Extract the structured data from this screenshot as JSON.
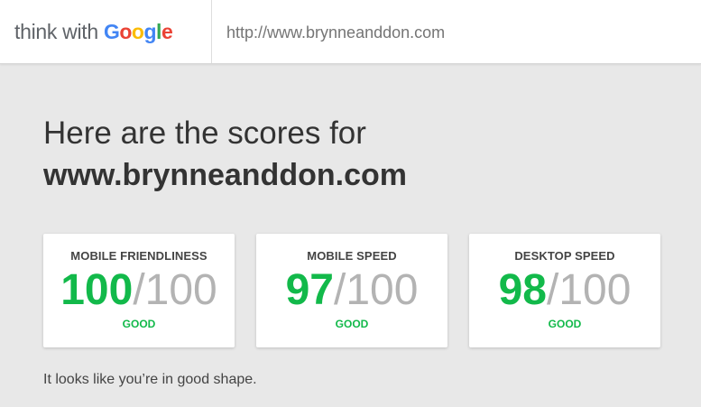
{
  "header": {
    "logo": {
      "prefix": "think with ",
      "g1": "G",
      "o1": "o",
      "o2": "o",
      "g2": "g",
      "l": "l",
      "e": "e"
    },
    "url": "http://www.brynneanddon.com"
  },
  "main": {
    "headline": "Here are the scores for",
    "domain": "www.brynneanddon.com",
    "cards": [
      {
        "title": "MOBILE FRIENDLINESS",
        "score": "100",
        "max": "/100",
        "rating": "GOOD"
      },
      {
        "title": "MOBILE SPEED",
        "score": "97",
        "max": "/100",
        "rating": "GOOD"
      },
      {
        "title": "DESKTOP SPEED",
        "score": "98",
        "max": "/100",
        "rating": "GOOD"
      }
    ],
    "footer": "It looks like you’re in good shape."
  },
  "colors": {
    "score_green": "#12b94a",
    "score_max_gray": "#b3b3b3",
    "background": "#e8e8e8",
    "google_blue": "#4285f4",
    "google_red": "#ea4335",
    "google_yellow": "#fbbc05",
    "google_green": "#34a853"
  }
}
